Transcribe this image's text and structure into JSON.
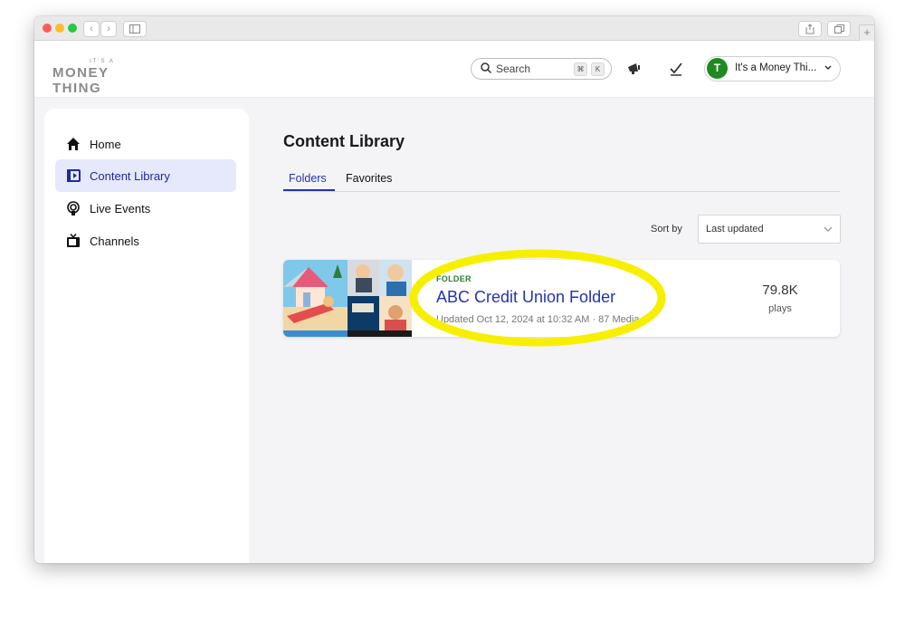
{
  "header": {
    "logo_small": "IT'S A",
    "logo_big": "MONEY THING",
    "search_label": "Search",
    "search_shortcut": [
      "⌘",
      "K"
    ],
    "account_initial": "T",
    "account_name": "It's a Money Thi..."
  },
  "sidebar": {
    "items": [
      {
        "label": "Home",
        "icon": "home-icon"
      },
      {
        "label": "Content Library",
        "icon": "content-library-icon",
        "active": true
      },
      {
        "label": "Live Events",
        "icon": "live-events-icon"
      },
      {
        "label": "Channels",
        "icon": "tv-icon"
      }
    ]
  },
  "main": {
    "title": "Content Library",
    "tabs": [
      {
        "label": "Folders",
        "active": true
      },
      {
        "label": "Favorites"
      }
    ],
    "sort_label": "Sort by",
    "sort_value": "Last updated",
    "card": {
      "kind": "FOLDER",
      "title": "ABC Credit Union Folder",
      "meta": "Updated Oct 12, 2024 at 10:32 AM · 87 Media",
      "plays_count": "79.8K",
      "plays_label": "plays"
    }
  },
  "colors": {
    "accent": "#2433b0",
    "folder_tag": "#2e7d32",
    "avatar": "#1f8a22",
    "highlight": "#f7ef00",
    "active_nav_bg": "#e6e8fb"
  }
}
